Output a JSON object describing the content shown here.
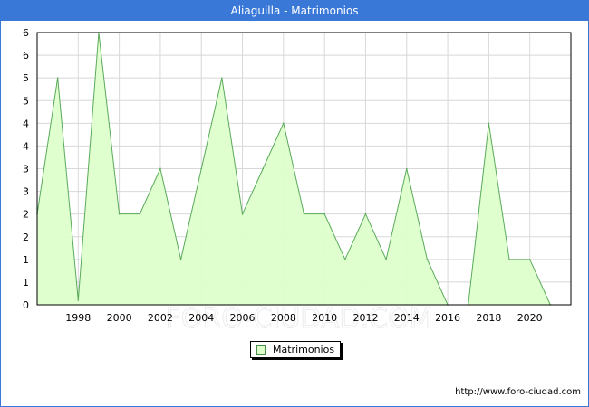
{
  "title": "Aliaguilla - Matrimonios",
  "source_text": "http://www.foro-ciudad.com",
  "watermark_text": "FORO-CIUDAD.COM",
  "colors": {
    "title_bar": "#3a78d8",
    "fill": "#ddffcc",
    "line": "#5aaa5a",
    "grid": "#d8d8d8"
  },
  "chart_data": {
    "type": "area",
    "title": "Aliaguilla - Matrimonios",
    "xlabel": "",
    "ylabel": "",
    "x": [
      1996,
      1997,
      1998,
      1999,
      2000,
      2001,
      2002,
      2003,
      2004,
      2005,
      2006,
      2007,
      2008,
      2009,
      2010,
      2011,
      2012,
      2013,
      2014,
      2015,
      2016,
      2017,
      2018,
      2019,
      2020,
      2021
    ],
    "x_ticks": [
      "1998",
      "2000",
      "2002",
      "2004",
      "2006",
      "2008",
      "2010",
      "2012",
      "2014",
      "2016",
      "2018",
      "2020"
    ],
    "y_ticks": [
      "0",
      "1",
      "1",
      "2",
      "2",
      "3",
      "3",
      "4",
      "4",
      "5",
      "5",
      "6",
      "6"
    ],
    "xlim": [
      1996,
      2022
    ],
    "ylim": [
      0,
      6
    ],
    "grid": true,
    "legend_position": "bottom-center",
    "series": [
      {
        "name": "Matrimonios",
        "values": [
          2,
          5,
          0.1,
          6,
          2,
          2,
          3,
          1,
          3,
          5,
          2,
          3,
          4,
          2,
          2,
          1,
          2,
          1,
          3,
          1,
          0,
          0,
          4,
          1,
          1,
          0
        ]
      }
    ]
  }
}
